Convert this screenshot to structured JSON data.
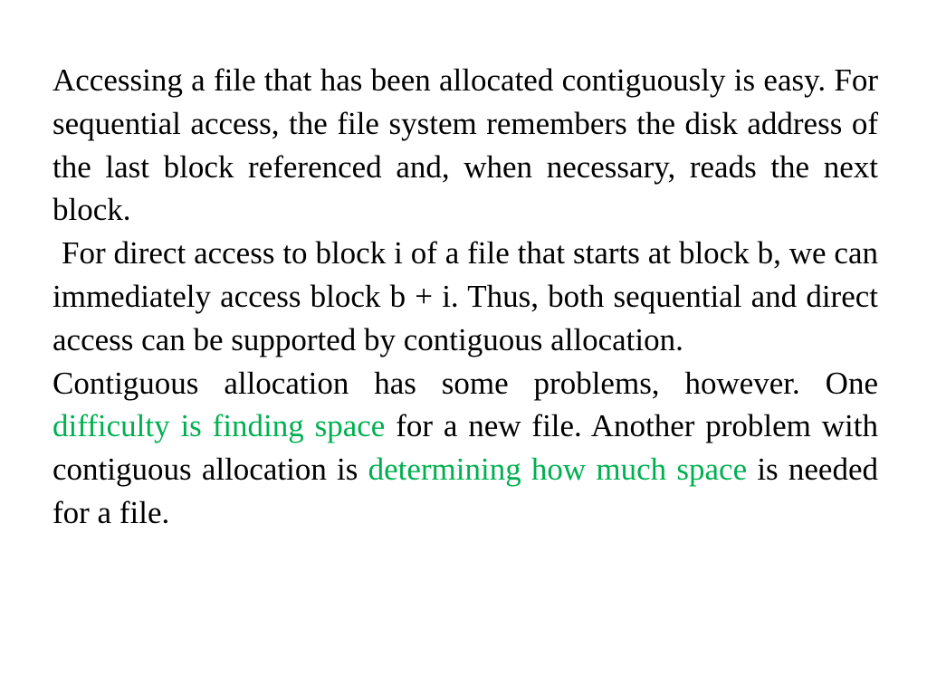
{
  "colors": {
    "text": "#000000",
    "highlight": "#00b050",
    "background": "#ffffff"
  },
  "paragraphs": [
    {
      "text": "Accessing a file that has been allocated contiguously is easy. For sequential access, the file system remembers the disk address of the last block referenced and, when necessary, reads the next block."
    },
    {
      "text": "For direct access to block i of a file that starts at block b, we can immediately access block b + i. Thus, both sequential and direct access can be supported by contiguous allocation."
    },
    {
      "segments": [
        {
          "text": "Contiguous allocation has some problems, however. One ",
          "highlight": false
        },
        {
          "text": "difficulty is finding space",
          "highlight": true
        },
        {
          "text": " for a new file. Another problem with contiguous allocation is ",
          "highlight": false
        },
        {
          "text": "determining how much space",
          "highlight": true
        },
        {
          "text": " is needed for a file.",
          "highlight": false
        }
      ]
    }
  ]
}
